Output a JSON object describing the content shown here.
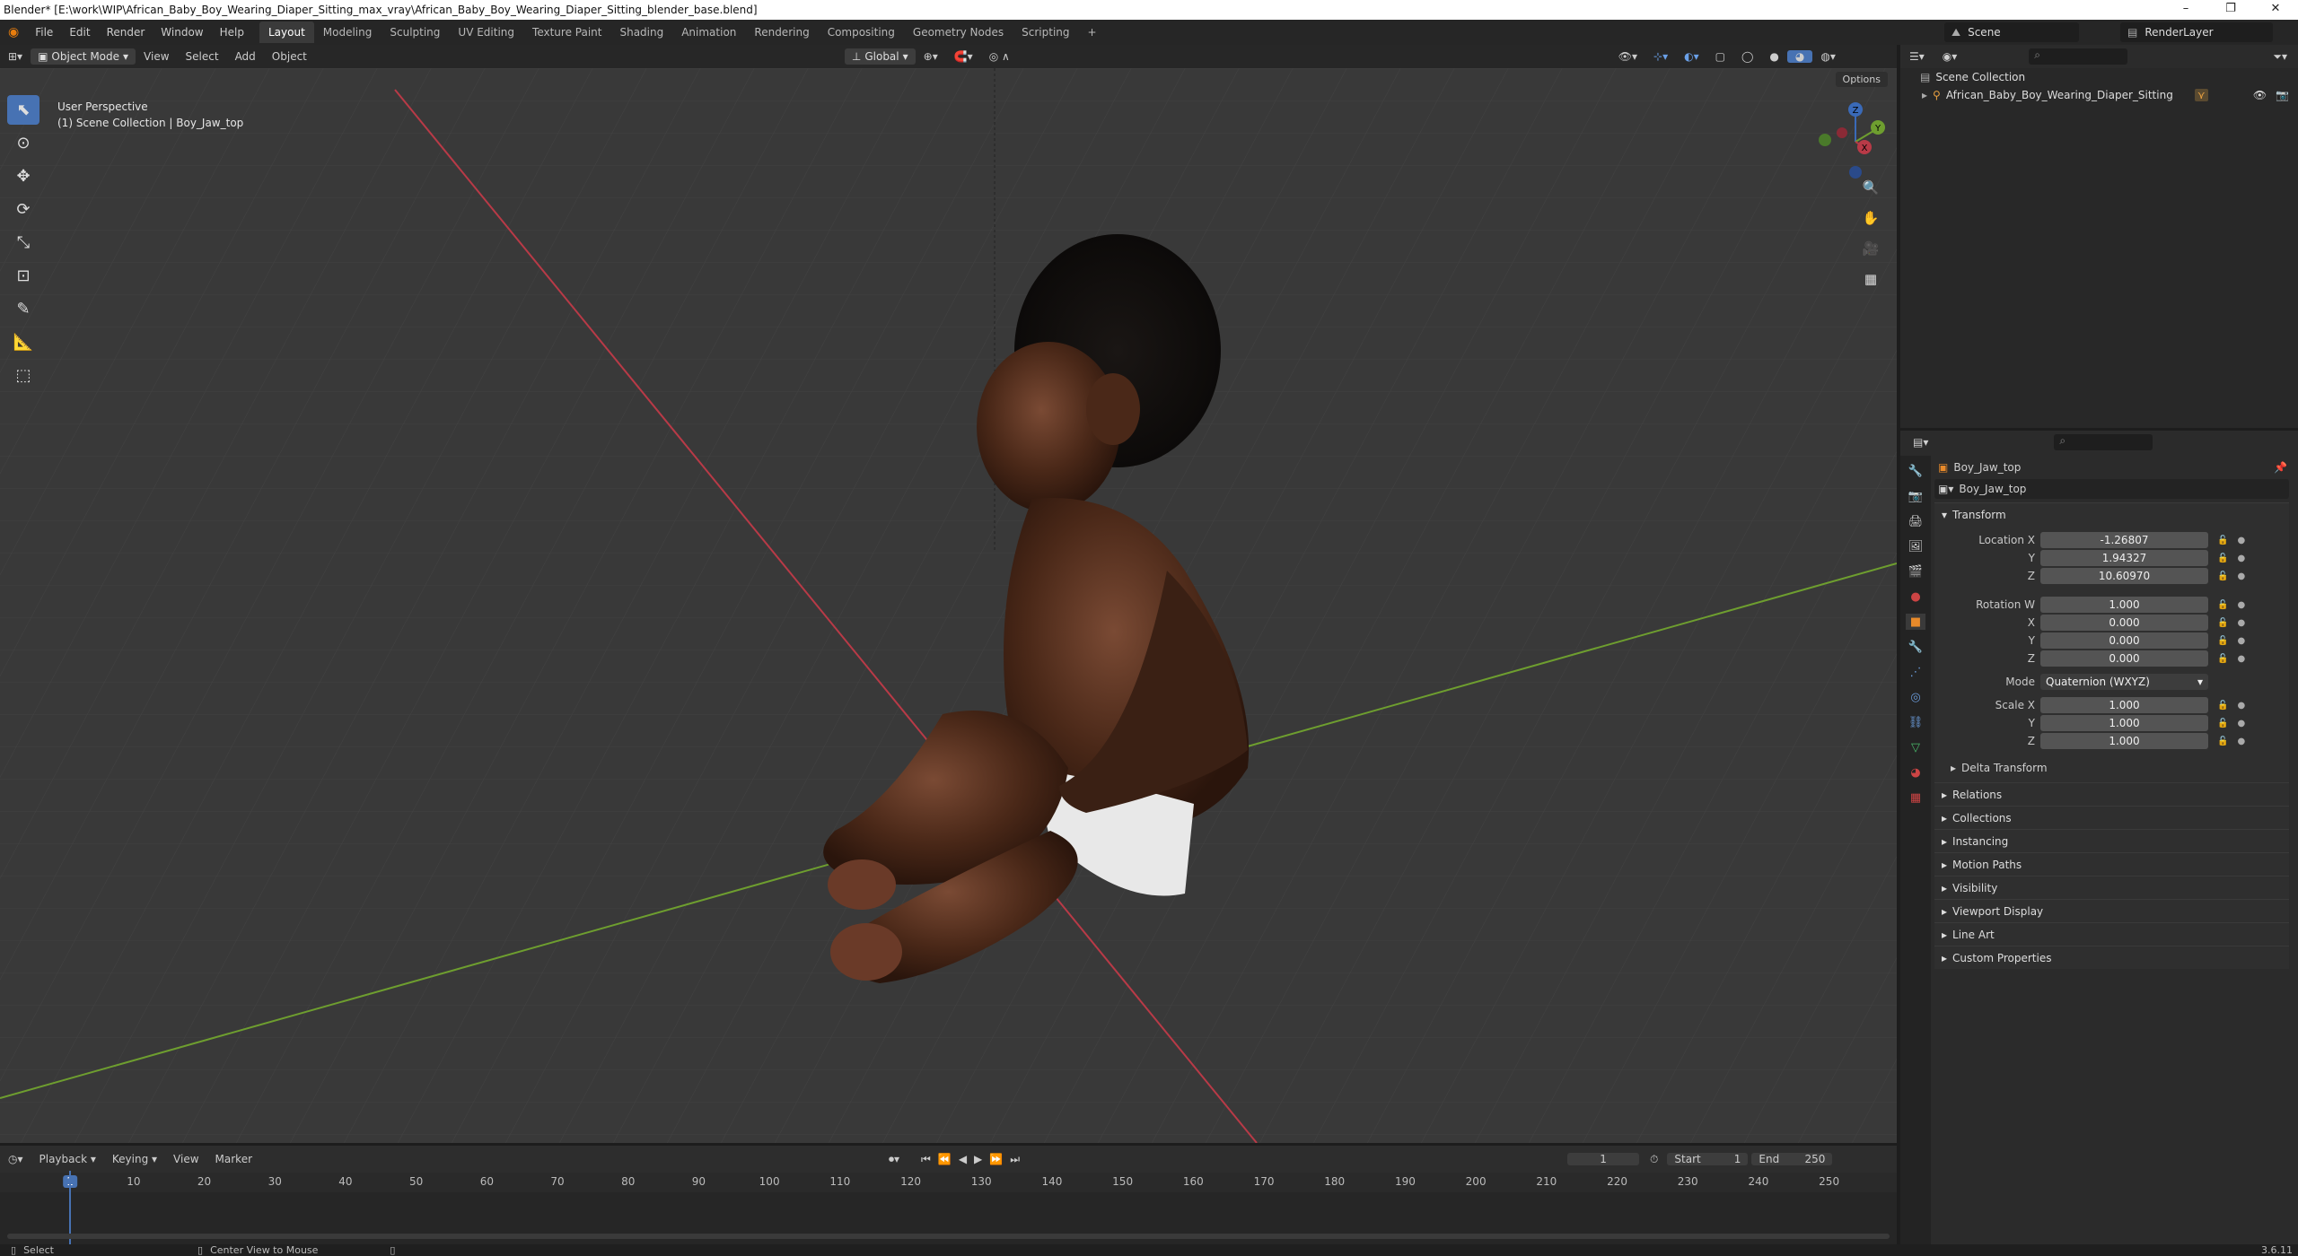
{
  "window": {
    "title": "Blender* [E:\\work\\WIP\\African_Baby_Boy_Wearing_Diaper_Sitting_max_vray\\African_Baby_Boy_Wearing_Diaper_Sitting_blender_base.blend]",
    "minimize": "–",
    "maximize": "❐",
    "close": "✕"
  },
  "menu": {
    "file": "File",
    "edit": "Edit",
    "render": "Render",
    "window": "Window",
    "help": "Help"
  },
  "workspaces": [
    "Layout",
    "Modeling",
    "Sculpting",
    "UV Editing",
    "Texture Paint",
    "Shading",
    "Animation",
    "Rendering",
    "Compositing",
    "Geometry Nodes",
    "Scripting",
    "+"
  ],
  "scene": {
    "name": "Scene",
    "view_layer": "RenderLayer"
  },
  "viewport_header": {
    "mode": "Object Mode",
    "view": "View",
    "select": "Select",
    "add": "Add",
    "object": "Object",
    "orientation": "Global",
    "options": "Options"
  },
  "viewport": {
    "perspective": "User Perspective",
    "collection_info": "(1) Scene Collection | Boy_Jaw_top",
    "gizmo": {
      "x": "X",
      "y": "Y",
      "z": "Z"
    }
  },
  "outliner": {
    "root": "Scene Collection",
    "item": "African_Baby_Boy_Wearing_Diaper_Sitting"
  },
  "properties": {
    "object_name": "Boy_Jaw_top",
    "data_name": "Boy_Jaw_top",
    "transform_title": "Transform",
    "location_label": "Location X",
    "location": {
      "x": "-1.26807",
      "y": "1.94327",
      "z": "10.60970"
    },
    "rotation_label": "Rotation W",
    "rotation": {
      "w": "1.000",
      "x": "0.000",
      "y": "0.000",
      "z": "0.000"
    },
    "mode_label": "Mode",
    "mode_value": "Quaternion (WXYZ)",
    "scale_label": "Scale X",
    "scale": {
      "x": "1.000",
      "y": "1.000",
      "z": "1.000"
    },
    "axis": {
      "y": "Y",
      "z": "Z",
      "x": "X"
    },
    "delta_transform": "Delta Transform",
    "panels": [
      "Relations",
      "Collections",
      "Instancing",
      "Motion Paths",
      "Visibility",
      "Viewport Display",
      "Line Art",
      "Custom Properties"
    ]
  },
  "timeline": {
    "playback": "Playback",
    "keying": "Keying",
    "view": "View",
    "marker": "Marker",
    "current_frame": "1",
    "start_label": "Start",
    "start": "1",
    "end_label": "End",
    "end": "250",
    "ticks": [
      "1",
      "10",
      "20",
      "30",
      "40",
      "50",
      "60",
      "70",
      "80",
      "90",
      "100",
      "110",
      "120",
      "130",
      "140",
      "150",
      "160",
      "170",
      "180",
      "190",
      "200",
      "210",
      "220",
      "230",
      "240",
      "250"
    ]
  },
  "status": {
    "select": "Select",
    "center_view": "Center View to Mouse",
    "version": "3.6.11"
  },
  "colors": {
    "accent": "#4772b3",
    "x_axis": "#b83a47",
    "y_axis": "#6e9e2f"
  }
}
